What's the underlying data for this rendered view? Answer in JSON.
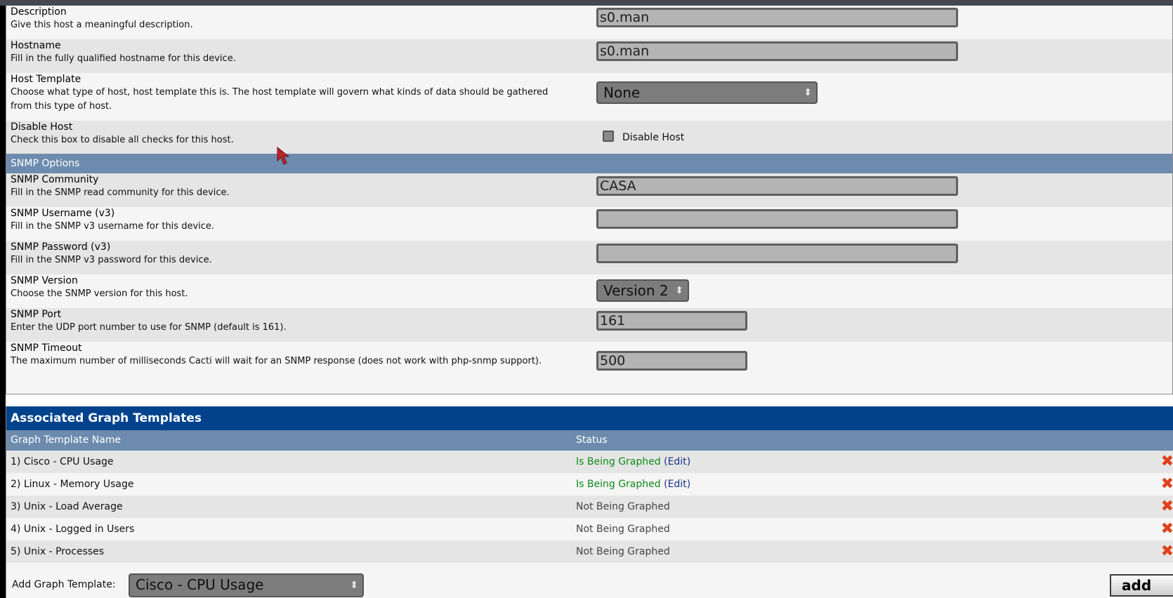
{
  "form": {
    "fields": [
      {
        "title": "Description",
        "desc": "Give this host a meaningful description.",
        "value": "s0.man"
      },
      {
        "title": "Hostname",
        "desc": "Fill in the fully qualified hostname for this device.",
        "value": "s0.man"
      },
      {
        "title": "Host Template",
        "desc": "Choose what type of host, host template this is. The host template will govern what kinds of data should be gathered from this type of host.",
        "value": "None"
      },
      {
        "title": "Disable Host",
        "desc": "Check this box to disable all checks for this host.",
        "checkbox_label": "Disable Host",
        "checked": false
      }
    ],
    "section_header": "SNMP Options",
    "snmp_fields": [
      {
        "title": "SNMP Community",
        "desc": "Fill in the SNMP read community for this device.",
        "value": "CASA"
      },
      {
        "title": "SNMP Username (v3)",
        "desc": "Fill in the SNMP v3 username for this device.",
        "value": ""
      },
      {
        "title": "SNMP Password (v3)",
        "desc": "Fill in the SNMP v3 password for this device.",
        "value": ""
      },
      {
        "title": "SNMP Version",
        "desc": "Choose the SNMP version for this host.",
        "value": "Version 2"
      },
      {
        "title": "SNMP Port",
        "desc": "Enter the UDP port number to use for SNMP (default is 161).",
        "value": "161"
      },
      {
        "title": "SNMP Timeout",
        "desc": "The maximum number of milliseconds Cacti will wait for an SNMP response (does not work with php-snmp support).",
        "value": "500"
      }
    ]
  },
  "graphs": {
    "title": "Associated Graph Templates",
    "col_name": "Graph Template Name",
    "col_status": "Status",
    "rows": [
      {
        "name": "1) Cisco - CPU Usage",
        "status": "Is Being Graphed",
        "edit": "Edit",
        "graphed": true
      },
      {
        "name": "2) Linux - Memory Usage",
        "status": "Is Being Graphed",
        "edit": "Edit",
        "graphed": true
      },
      {
        "name": "3) Unix - Load Average",
        "status": "Not Being Graphed",
        "graphed": false
      },
      {
        "name": "4) Unix - Logged in Users",
        "status": "Not Being Graphed",
        "graphed": false
      },
      {
        "name": "5) Unix - Processes",
        "status": "Not Being Graphed",
        "graphed": false
      }
    ],
    "delete_icon": "✖",
    "add_label": "Add Graph Template:",
    "add_select": "Cisco - CPU Usage",
    "add_button": "add"
  },
  "colors": {
    "header_dark": "#00438c",
    "header_light": "#6d8bad",
    "graphed_green": "#0d8a1a",
    "delete_red": "#e0401a"
  }
}
